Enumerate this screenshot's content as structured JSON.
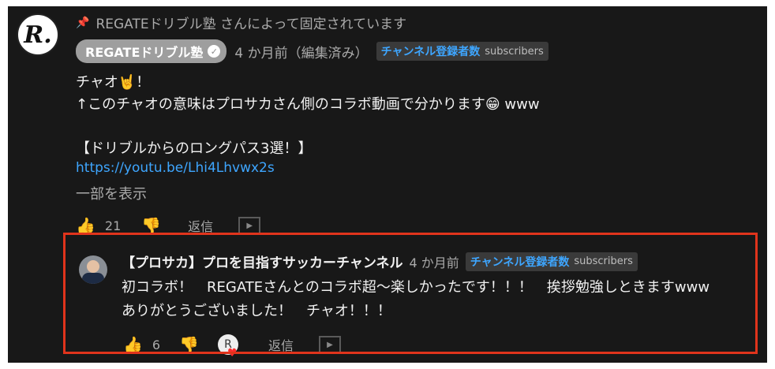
{
  "pinned": {
    "text": "REGATEドリブル塾 さんによって固定されています",
    "icon": "pin-icon"
  },
  "comment": {
    "author": "REGATEドリブル塾",
    "timestamp": "4 か月前（編集済み）",
    "badge_jp": "チャンネル登録者数",
    "badge_en": "subscribers",
    "line1": "チャオ🤘！",
    "line2": "↑このチャオの意味はプロサカさん側のコラボ動画で分かります😁 www",
    "line3": "【ドリブルからのロングパス3選！】",
    "link": "https://youtu.be/Lhi4Lhvwx2s",
    "read_more": "一部を表示",
    "likes": "21",
    "reply_label": "返信"
  },
  "reply": {
    "author": "【プロサカ】プロを目指すサッカーチャンネル",
    "timestamp": "4 か月前",
    "badge_jp": "チャンネル登録者数",
    "badge_en": "subscribers",
    "line1": "初コラボ！　REGATEさんとのコラボ超〜楽しかったです！！！　挨拶勉強しときますwww",
    "line2": "ありがとうございました！　チャオ！！！",
    "likes": "6",
    "reply_label": "返信"
  },
  "colors": {
    "highlight_border": "#e0341c",
    "link": "#3ea6ff",
    "background": "#181818"
  }
}
